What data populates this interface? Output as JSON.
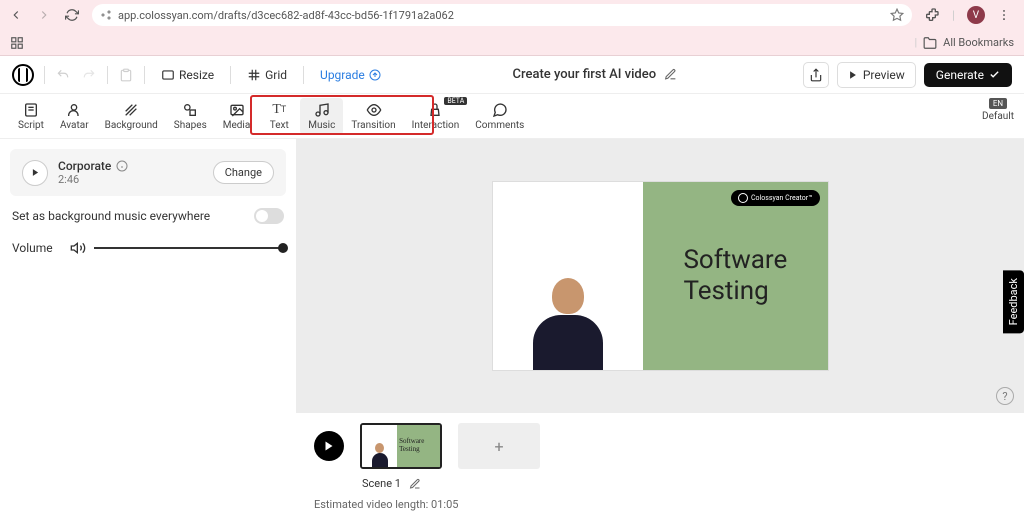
{
  "browser": {
    "url": "app.colossyan.com/drafts/d3cec682-ad8f-43cc-bd56-1f1791a2a062",
    "profile_initial": "V",
    "bookmarks_label": "All Bookmarks"
  },
  "appbar": {
    "resize": "Resize",
    "grid": "Grid",
    "upgrade": "Upgrade",
    "title": "Create your first AI video",
    "preview": "Preview",
    "generate": "Generate"
  },
  "toolbar": {
    "items": [
      {
        "label": "Script"
      },
      {
        "label": "Avatar"
      },
      {
        "label": "Background"
      },
      {
        "label": "Shapes"
      },
      {
        "label": "Media"
      },
      {
        "label": "Text"
      },
      {
        "label": "Music"
      },
      {
        "label": "Transition"
      },
      {
        "label": "Interaction"
      },
      {
        "label": "Comments"
      }
    ],
    "lang_badge": "EN",
    "lang_label": "Default",
    "beta": "BETA"
  },
  "music": {
    "track_name": "Corporate",
    "duration": "2:46",
    "change": "Change",
    "bg_toggle_label": "Set as background music everywhere",
    "volume_label": "Volume"
  },
  "slide": {
    "title_line1": "Software",
    "title_line2": "Testing",
    "badge": "Colossyan Creator™"
  },
  "timeline": {
    "scene_label": "Scene 1",
    "thumb_text": "Software Testing",
    "estimated": "Estimated video length: 01:05"
  },
  "feedback": "Feedback"
}
